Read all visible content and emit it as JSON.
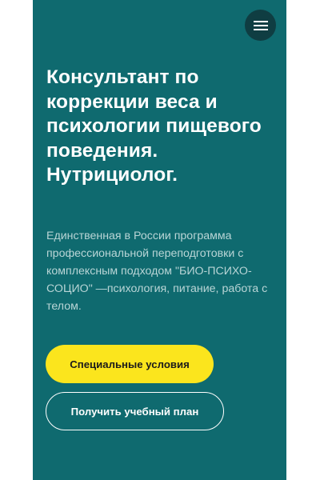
{
  "hero": {
    "title": "Консультант по коррекции веса и психологии пищевого поведения. Нутрициолог.",
    "description": "Единственная в России программа профессиональной переподготовки с комплексным подходом \"БИО-ПСИХО-СОЦИО\" —психология, питание, работа с телом.",
    "primary_button": "Специальные условия",
    "secondary_button": "Получить учебный план"
  },
  "header": {
    "menu_icon": "hamburger-menu-icon"
  },
  "colors": {
    "panel_background": "#0f6a6f",
    "menu_button_background": "#0f3d42",
    "accent_yellow": "#fbe51d",
    "text_white": "#ffffff",
    "text_muted": "#b9d5d6"
  }
}
